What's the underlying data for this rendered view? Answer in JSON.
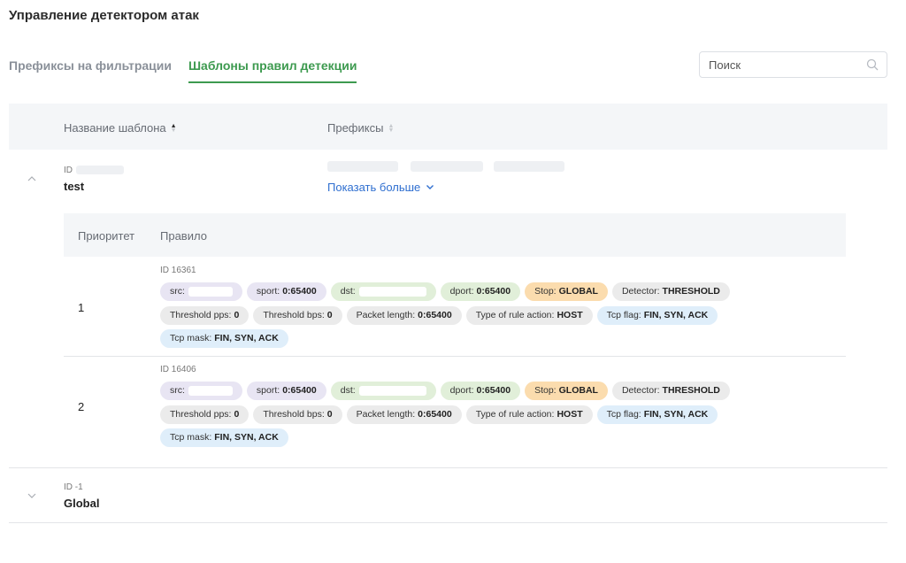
{
  "page": {
    "title": "Управление детектором атак"
  },
  "tabs": [
    {
      "label": "Префиксы на фильтрации",
      "active": false
    },
    {
      "label": "Шаблоны правил детекции",
      "active": true
    }
  ],
  "search": {
    "placeholder": "Поиск"
  },
  "table": {
    "columns": {
      "name": "Название шаблона",
      "prefixes": "Префиксы"
    },
    "templates": [
      {
        "id_label": "ID",
        "name": "test",
        "expanded": true,
        "show_more": "Показать больше"
      },
      {
        "id_label": "ID -1",
        "name": "Global",
        "expanded": false
      }
    ]
  },
  "rules_table": {
    "columns": {
      "priority": "Приоритет",
      "rule": "Правило"
    },
    "rules": [
      {
        "priority": "1",
        "id": "ID 16361",
        "chips": {
          "src": "src:",
          "sport_k": "sport:",
          "sport_v": "0:65400",
          "dst": "dst:",
          "dport_k": "dport:",
          "dport_v": "0:65400",
          "stop_k": "Stop:",
          "stop_v": "GLOBAL",
          "detector_k": "Detector:",
          "detector_v": "THRESHOLD",
          "pps_k": "Threshold pps:",
          "pps_v": "0",
          "bps_k": "Threshold bps:",
          "bps_v": "0",
          "len_k": "Packet length:",
          "len_v": "0:65400",
          "action_k": "Type of rule action:",
          "action_v": "HOST",
          "flag_k": "Tcp flag:",
          "flag_v": "FIN, SYN, ACK",
          "mask_k": "Tcp mask:",
          "mask_v": "FIN, SYN, ACK"
        }
      },
      {
        "priority": "2",
        "id": "ID 16406",
        "chips": {
          "src": "src:",
          "sport_k": "sport:",
          "sport_v": "0:65400",
          "dst": "dst:",
          "dport_k": "dport:",
          "dport_v": "0:65400",
          "stop_k": "Stop:",
          "stop_v": "GLOBAL",
          "detector_k": "Detector:",
          "detector_v": "THRESHOLD",
          "pps_k": "Threshold pps:",
          "pps_v": "0",
          "bps_k": "Threshold bps:",
          "bps_v": "0",
          "len_k": "Packet length:",
          "len_v": "0:65400",
          "action_k": "Type of rule action:",
          "action_v": "HOST",
          "flag_k": "Tcp flag:",
          "flag_v": "FIN, SYN, ACK",
          "mask_k": "Tcp mask:",
          "mask_v": "FIN, SYN, ACK"
        }
      }
    ]
  },
  "colors": {
    "accent_green": "#3d9a4f",
    "link_blue": "#2f6fd0",
    "chip_purple": "#e8e5f3",
    "chip_green": "#e1efd9",
    "chip_orange": "#fbdcae",
    "chip_gray": "#ebebeb",
    "chip_blue": "#dfeefa"
  },
  "icons": [
    "search-icon",
    "sort-icon",
    "chevron-up-icon",
    "chevron-down-icon"
  ]
}
